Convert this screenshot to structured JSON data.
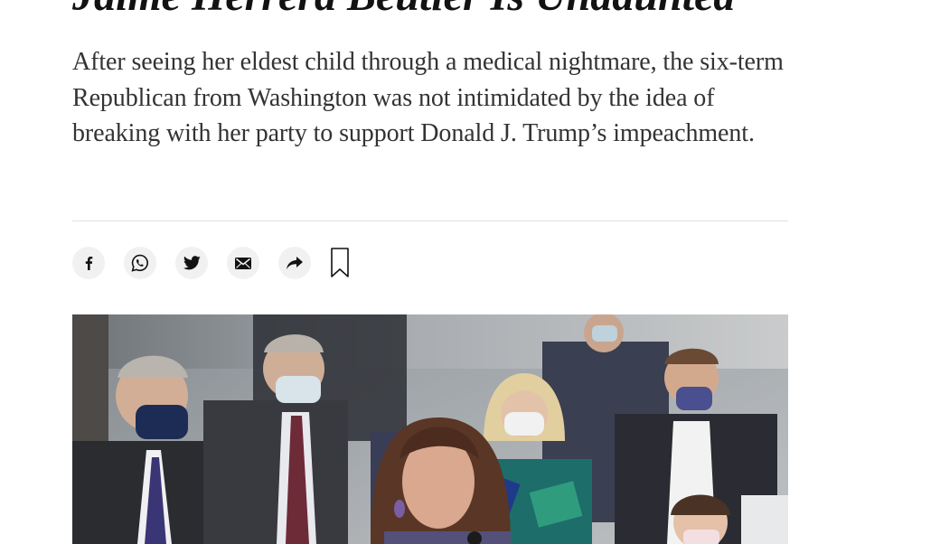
{
  "article": {
    "headline": "Jaime Herrera Beutler Is Undaunted",
    "summary": "After seeing her eldest child through a medical nightmare, the six-term Republican from Washington was not intimidated by the idea of breaking with her party to support Donald J. Trump’s impeachment."
  },
  "share_bar": {
    "buttons": [
      {
        "icon": "facebook-icon"
      },
      {
        "icon": "whatsapp-icon"
      },
      {
        "icon": "twitter-icon"
      },
      {
        "icon": "email-icon"
      },
      {
        "icon": "share-arrow-icon"
      }
    ],
    "save_icon": "bookmark-icon"
  },
  "colors": {
    "text": "#121212",
    "summary_text": "#333333",
    "button_bg": "#f1f1f1",
    "divider": "#dfdfdf"
  }
}
